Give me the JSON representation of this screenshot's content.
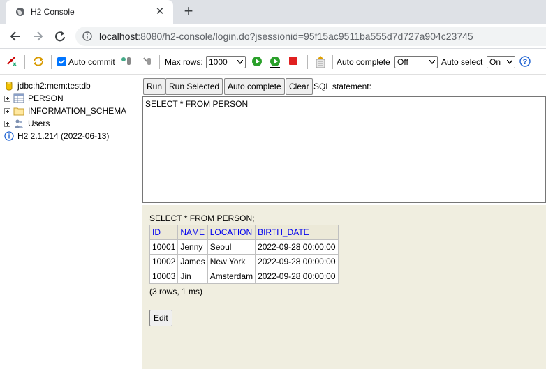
{
  "browser": {
    "tab_title": "H2 Console",
    "url_host": "localhost",
    "url_rest": ":8080/h2-console/login.do?jsessionid=95f15ac9511ba555d7d727a904c23745"
  },
  "toolbar": {
    "auto_commit_label": "Auto commit",
    "max_rows_label": "Max rows:",
    "max_rows_value": "1000",
    "auto_complete_label": "Auto complete",
    "auto_complete_value": "Off",
    "auto_select_label": "Auto select",
    "auto_select_value": "On",
    "help_glyph": "?"
  },
  "tree": {
    "connection": "jdbc:h2:mem:testdb",
    "items": [
      {
        "label": "PERSON"
      },
      {
        "label": "INFORMATION_SCHEMA"
      },
      {
        "label": "Users"
      }
    ],
    "version": "H2 2.1.214 (2022-06-13)"
  },
  "query": {
    "run_label": "Run",
    "run_selected_label": "Run Selected",
    "auto_complete_label": "Auto complete",
    "clear_label": "Clear",
    "sql_label": "SQL statement:",
    "sql_text": "SELECT * FROM PERSON"
  },
  "result": {
    "sql": "SELECT * FROM PERSON;",
    "columns": [
      "ID",
      "NAME",
      "LOCATION",
      "BIRTH_DATE"
    ],
    "rows": [
      [
        "10001",
        "Jenny",
        "Seoul",
        "2022-09-28 00:00:00"
      ],
      [
        "10002",
        "James",
        "New York",
        "2022-09-28 00:00:00"
      ],
      [
        "10003",
        "Jin",
        "Amsterdam",
        "2022-09-28 00:00:00"
      ]
    ],
    "count": "(3 rows, 1 ms)",
    "edit_label": "Edit"
  },
  "colors": {
    "result_bg": "#f0eee0",
    "header_link": "#0000ee",
    "checkbox": "#0075ff"
  }
}
